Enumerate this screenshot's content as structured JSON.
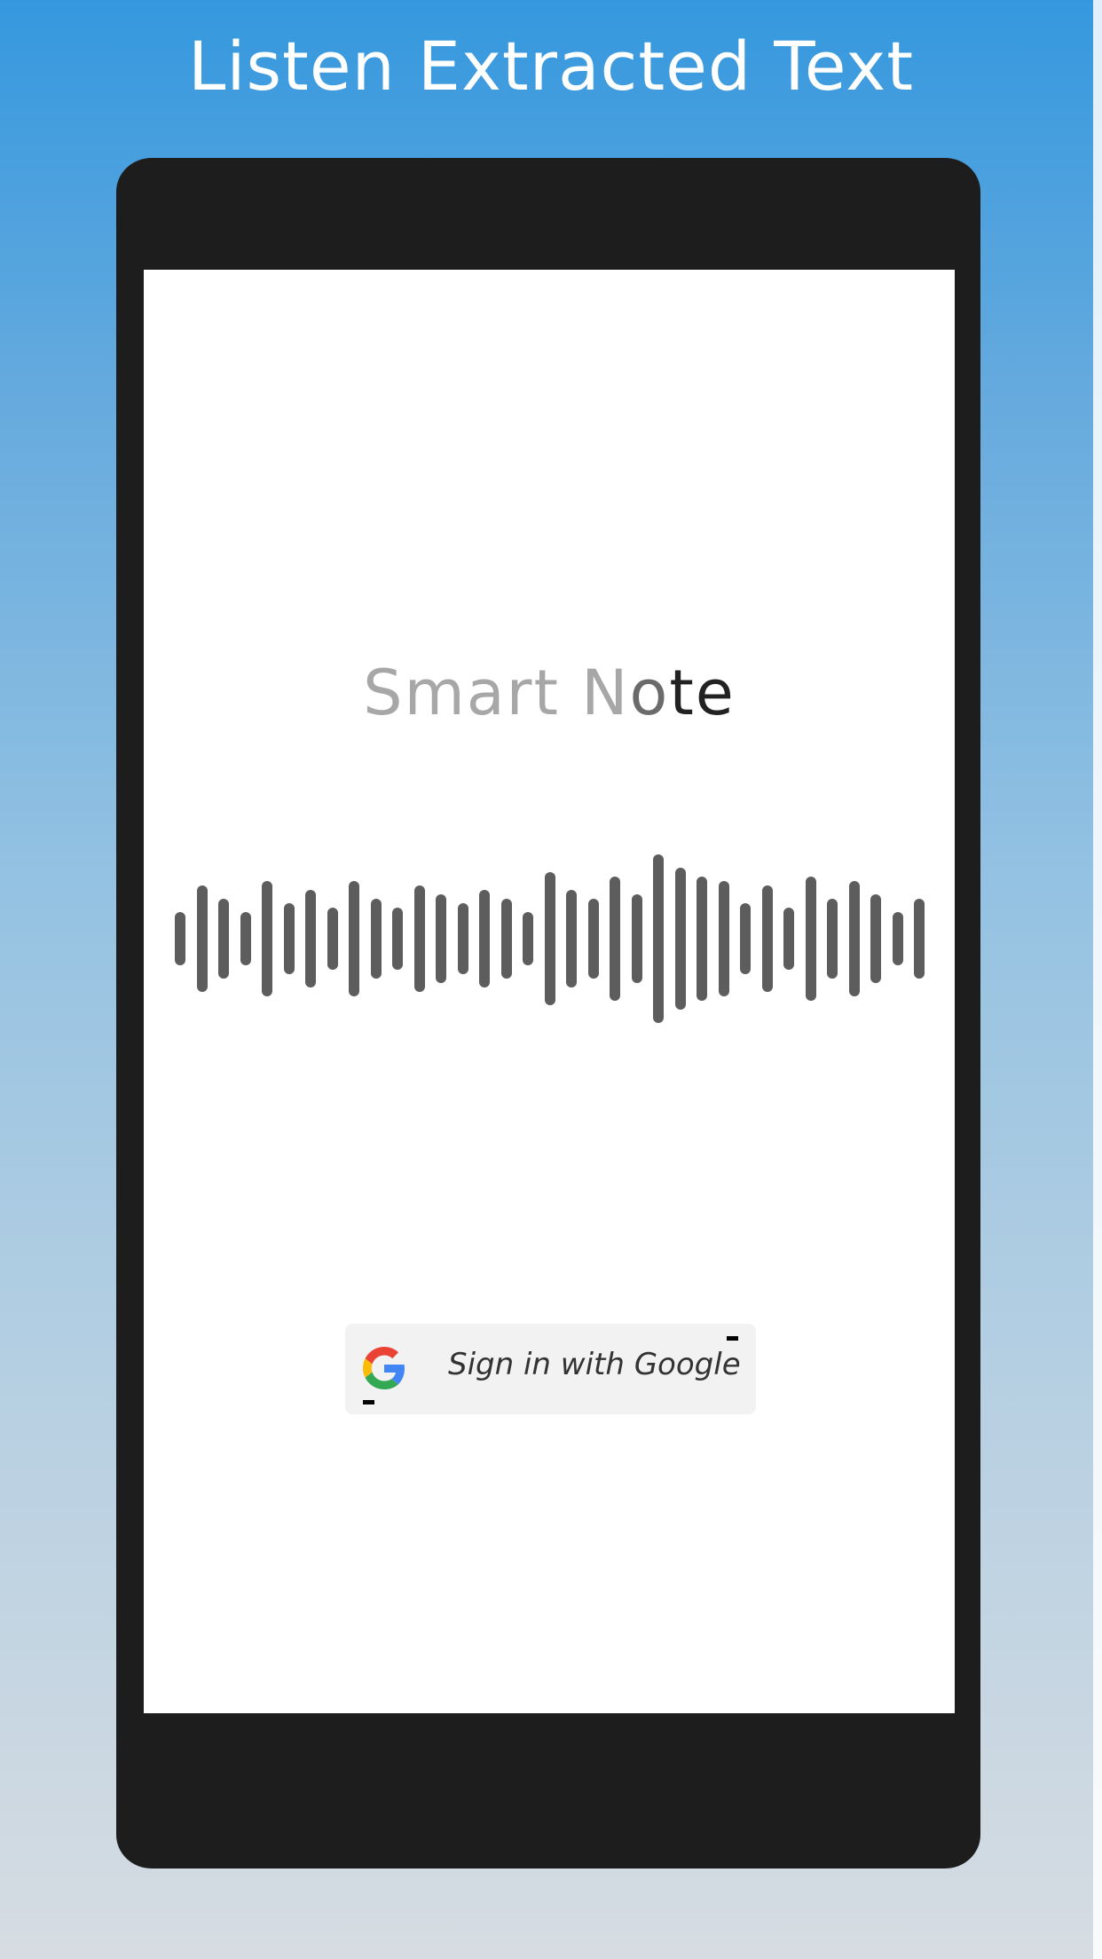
{
  "promo": {
    "headline": "Listen Extracted Text"
  },
  "app": {
    "title_part1": "Smart N",
    "title_part2": "o",
    "title_part3": "te"
  },
  "auth": {
    "google_button_label": "Sign in with Google",
    "google_icon": "google-g-icon"
  },
  "colors": {
    "background_top": "#3598de",
    "background_bottom": "#d6dce2",
    "phone_body": "#1d1d1d",
    "waveform": "#5d5d5d",
    "button_bg": "#f2f2f2"
  }
}
